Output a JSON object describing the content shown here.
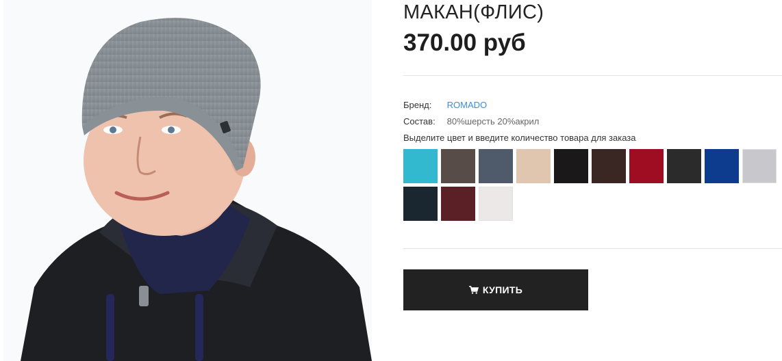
{
  "product": {
    "title": "МАКАН(ФЛИС)",
    "price": "370.00 руб",
    "image_alt": "Мужская вязаная шапка серого цвета"
  },
  "attributes": {
    "brand_label": "Бренд:",
    "brand_value": "ROMADO",
    "composition_label": "Состав:",
    "composition_value": "80%шерсть 20%акрил"
  },
  "color_prompt": "Выделите цвет и введите количество товара для заказа",
  "swatches": [
    {
      "name": "turquoise",
      "color": "#33b9cf"
    },
    {
      "name": "dark-brown-grey",
      "color": "#574c47"
    },
    {
      "name": "slate-blue-grey",
      "color": "#4f5a6a"
    },
    {
      "name": "beige",
      "color": "#e0c6ae"
    },
    {
      "name": "black",
      "color": "#1a1818"
    },
    {
      "name": "dark-brown",
      "color": "#3a2622"
    },
    {
      "name": "burgundy",
      "color": "#9e0d22"
    },
    {
      "name": "charcoal",
      "color": "#2b2b2b"
    },
    {
      "name": "royal-blue",
      "color": "#0d3c8f"
    },
    {
      "name": "light-grey",
      "color": "#c7c7cc"
    },
    {
      "name": "dark-navy",
      "color": "#1a2630"
    },
    {
      "name": "maroon",
      "color": "#5a2026"
    },
    {
      "name": "off-white",
      "color": "#ece8e8"
    }
  ],
  "buy_button": {
    "label": "КУПИТЬ",
    "icon": "cart-icon"
  }
}
